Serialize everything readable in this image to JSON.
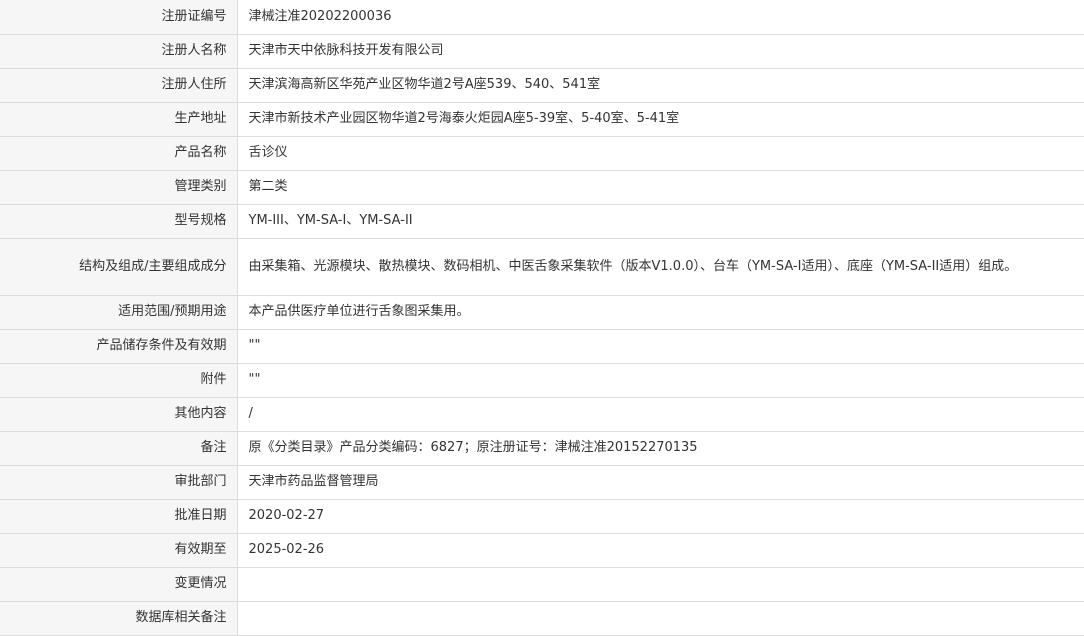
{
  "rows": [
    {
      "label": "注册证编号",
      "value": "津械注准20202200036"
    },
    {
      "label": "注册人名称",
      "value": "天津市天中依脉科技开发有限公司"
    },
    {
      "label": "注册人住所",
      "value": "天津滨海高新区华苑产业区物华道2号A座539、540、541室"
    },
    {
      "label": "生产地址",
      "value": "天津市新技术产业园区物华道2号海泰火炬园A座5-39室、5-40室、5-41室"
    },
    {
      "label": "产品名称",
      "value": "舌诊仪"
    },
    {
      "label": "管理类别",
      "value": "第二类"
    },
    {
      "label": "型号规格",
      "value": "YM-III、YM-SA-I、YM-SA-II"
    },
    {
      "label": "结构及组成/主要组成成分",
      "value": "由采集箱、光源模块、散热模块、数码相机、中医舌象采集软件（版本V1.0.0）、台车（YM-SA-I适用）、底座（YM-SA-II适用）组成。"
    },
    {
      "label": "适用范围/预期用途",
      "value": "本产品供医疗单位进行舌象图采集用。"
    },
    {
      "label": "产品储存条件及有效期",
      "value": "\"\""
    },
    {
      "label": "附件",
      "value": "\"\""
    },
    {
      "label": "其他内容",
      "value": "/"
    },
    {
      "label": "备注",
      "value": "原《分类目录》产品分类编码：6827；原注册证号：津械注准20152270135"
    },
    {
      "label": "审批部门",
      "value": "天津市药品监督管理局"
    },
    {
      "label": "批准日期",
      "value": "2020-02-27"
    },
    {
      "label": "有效期至",
      "value": "2025-02-26"
    },
    {
      "label": "变更情况",
      "value": ""
    },
    {
      "label": "数据库相关备注",
      "value": ""
    }
  ]
}
